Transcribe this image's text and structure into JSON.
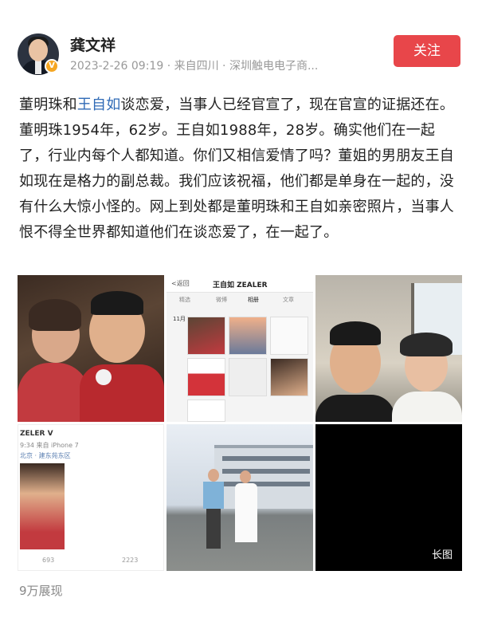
{
  "header": {
    "author": "龚文祥",
    "meta": "2023-2-26 09:19 · 来自四川 · 深圳触电电子商...",
    "follow_label": "关注",
    "verified_badge": "V"
  },
  "post": {
    "segments": [
      {
        "text": "董明珠和",
        "highlight": false
      },
      {
        "text": "王自如",
        "highlight": true
      },
      {
        "text": "谈恋爱，当事人已经官宣了，现在官宣的证据还在。董明珠1954年，62岁。王自如1988年，28岁。确实他们在一起了，行业内每个人都知道。你们又相信爱情了吗？董姐的男朋友王自如现在是格力的副总裁。我们应该祝福，他们都是单身在一起的，没有什么大惊小怪的。网上到处都是董明珠和王自如亲密照片，当事人恨不得全世界都知道他们在谈恋爱了，在一起了。",
        "highlight": false
      }
    ],
    "highlight_color": "#2f6ab6"
  },
  "images": {
    "c2": {
      "back": "<返回",
      "title": "王自如 ZEALER",
      "tabs": [
        "精选",
        "微博",
        "相册",
        "文章"
      ],
      "month": "11月"
    },
    "c4": {
      "title": "ZELER V",
      "sub": "9:34 来自 iPhone 7",
      "loc": "北京 · 建东苑东区",
      "stat_left": "693",
      "stat_right": "2223"
    },
    "c6_label": "长图"
  },
  "footer": {
    "views": "9万展现"
  },
  "colors": {
    "accent": "#e8464a",
    "link": "#2f6ab6",
    "meta": "#999999"
  }
}
